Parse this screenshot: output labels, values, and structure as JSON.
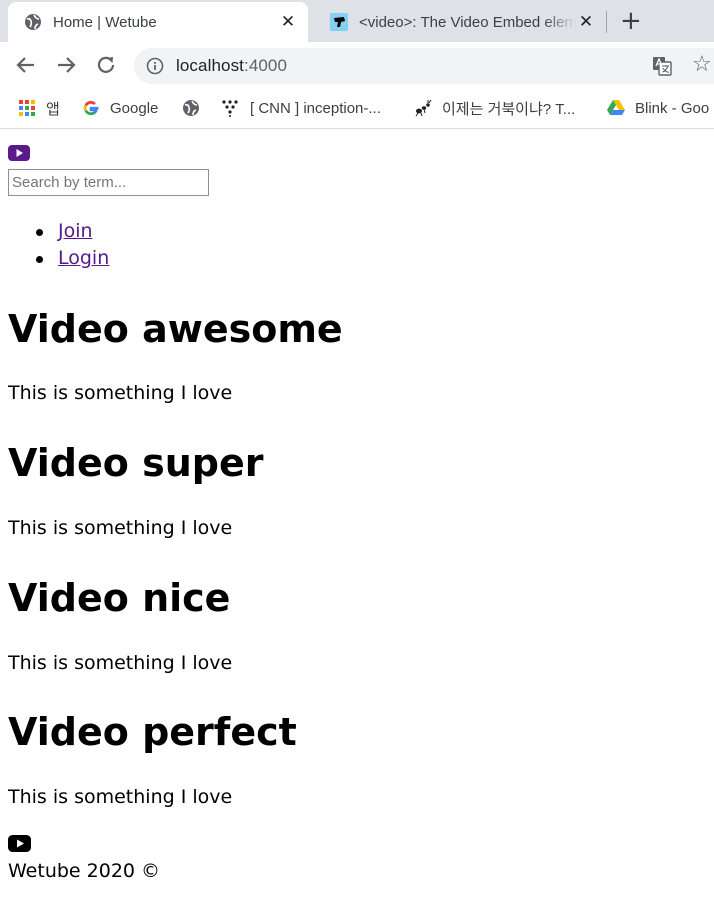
{
  "browser": {
    "tabs": [
      {
        "title": "Home | Wetube",
        "active": true
      },
      {
        "title": "<video>: The Video Embed element",
        "active": false
      }
    ],
    "close_glyph": "✕",
    "new_tab_glyph": "+",
    "address": {
      "host": "localhost",
      "port": ":4000"
    },
    "bookmarks": [
      {
        "label": "앱",
        "icon": "apps-grid-icon"
      },
      {
        "label": "Google",
        "icon": "google-icon"
      },
      {
        "label": "",
        "icon": "globe-icon"
      },
      {
        "label": "[ CNN ] inception-...",
        "icon": "cnn-dots-icon"
      },
      {
        "label": "이제는 거북이냐? T...",
        "icon": "ant-icon"
      },
      {
        "label": "Blink - Goo",
        "icon": "google-drive-icon"
      }
    ]
  },
  "header": {
    "search_placeholder": "Search by term...",
    "nav": [
      "Join",
      "Login"
    ]
  },
  "videos": [
    {
      "title": "Video awesome",
      "description": "This is something I love"
    },
    {
      "title": "Video super",
      "description": "This is something I love"
    },
    {
      "title": "Video nice",
      "description": "This is something I love"
    },
    {
      "title": "Video perfect",
      "description": "This is something I love"
    }
  ],
  "footer": {
    "text": "Wetube 2020 ©"
  },
  "colors": {
    "logo_purple": "#5b1a8b",
    "link_visited": "#551a8b",
    "chrome_bg": "#dee1e6"
  }
}
